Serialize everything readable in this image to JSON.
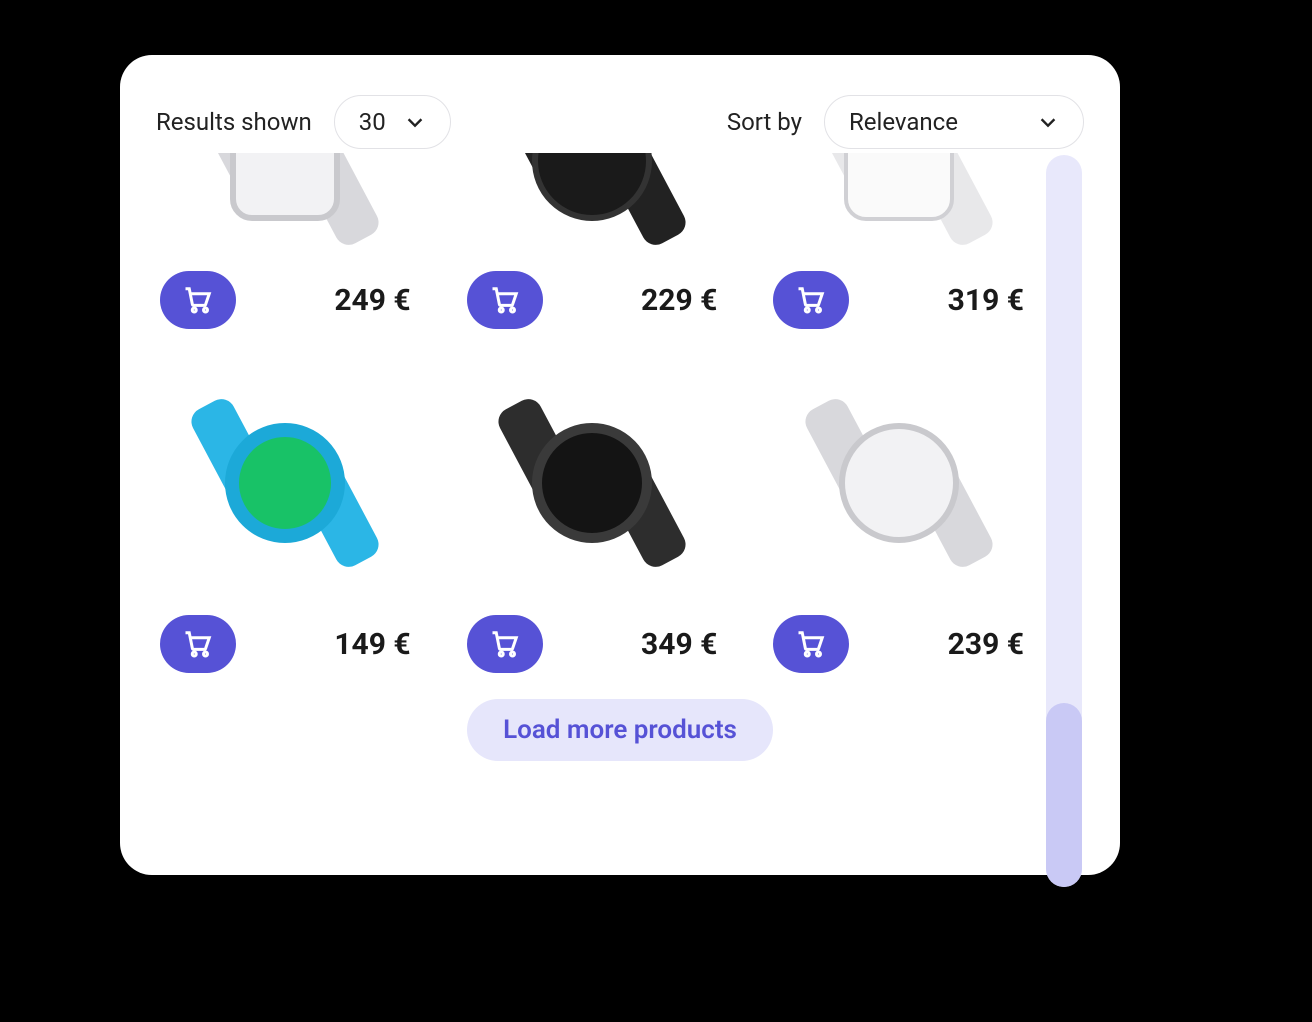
{
  "toolbar": {
    "results_label": "Results shown",
    "results_value": "30",
    "sort_label": "Sort by",
    "sort_value": "Relevance"
  },
  "products": [
    {
      "price": "249 €",
      "style": "square silver"
    },
    {
      "price": "229 €",
      "style": "round black"
    },
    {
      "price": "319 €",
      "style": "square white"
    },
    {
      "price": "149 €",
      "style": "round blue"
    },
    {
      "price": "349 €",
      "style": "round darkgrey"
    },
    {
      "price": "239 €",
      "style": "round silver"
    }
  ],
  "load_more_label": "Load more products"
}
